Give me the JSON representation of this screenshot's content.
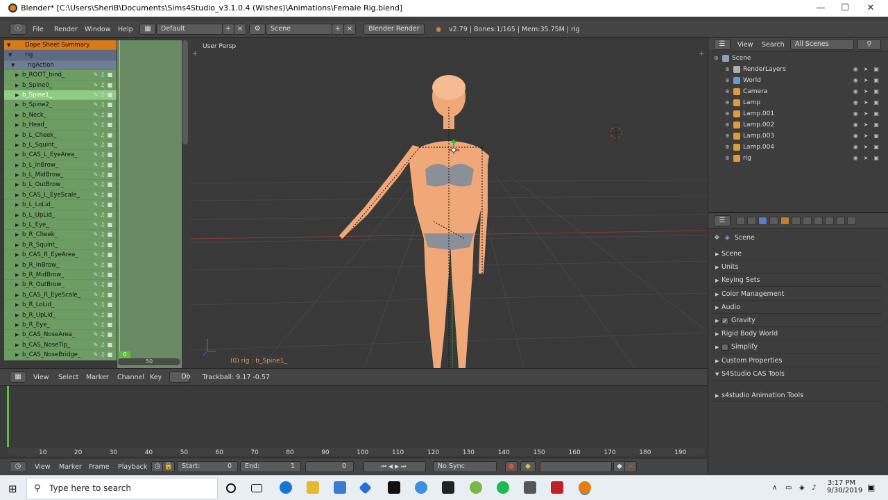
{
  "window": {
    "title": "Blender* [C:\\Users\\SheriB\\Documents\\Sims4Studio_v3.1.0.4 (Wishes)\\Animations\\Female Rig.blend]"
  },
  "menu": {
    "items": [
      "File",
      "Render",
      "Window",
      "Help"
    ],
    "layout": "Default",
    "scene": "Scene",
    "engine": "Blender Render",
    "stats": "v2.79 | Bones:1/165  | Mem:35.75M | rig"
  },
  "dopesheet": {
    "summary": "Dope Sheet Summary",
    "object": "rig",
    "action": "rigAction",
    "bones": [
      "b_ROOT_bind_",
      "b_Spine0_",
      "b_Spine1_",
      "b_Spine2_",
      "b_Neck_",
      "b_Head_",
      "b_L_Cheek_",
      "b_L_Squint_",
      "b_CAS_L_EyeArea_",
      "b_L_InBrow_",
      "b_L_MidBrow_",
      "b_L_OutBrow_",
      "b_CAS_L_EyeScale_",
      "b_L_LoLid_",
      "b_L_UpLid_",
      "b_L_Eye_",
      "b_R_Cheek_",
      "b_R_Squint_",
      "b_CAS_R_EyeArea_",
      "b_R_InBrow_",
      "b_R_MidBrow_",
      "b_R_OutBrow_",
      "b_CAS_R_EyeScale_",
      "b_R_LoLid_",
      "b_R_UpLid_",
      "b_R_Eye_",
      "b_CAS_NoseArea_",
      "b_CAS_NoseTip_",
      "b_CAS_NoseBridge_"
    ],
    "selected_bone_index": 2,
    "current_frame": "0",
    "ruler_label": "50",
    "header": {
      "items": [
        "View",
        "Select",
        "Marker",
        "Channel",
        "Key"
      ],
      "mode": "Do"
    }
  },
  "viewport": {
    "label": "User Persp",
    "object_label": "(0) rig : b_Spine1_",
    "trackball": "Trackball: 9.17 -0.57"
  },
  "outliner": {
    "header": {
      "view": "View",
      "search": "Search",
      "filter": "All Scenes"
    },
    "items": [
      {
        "name": "Scene",
        "depth": 0,
        "icon_color": "#8aa0c0"
      },
      {
        "name": "RenderLayers",
        "depth": 1,
        "icon_color": "#b0b0b0"
      },
      {
        "name": "World",
        "depth": 1,
        "icon_color": "#6a9ad0"
      },
      {
        "name": "Camera",
        "depth": 1,
        "icon_color": "#e09a3a"
      },
      {
        "name": "Lamp",
        "depth": 1,
        "icon_color": "#e09a3a"
      },
      {
        "name": "Lamp.001",
        "depth": 1,
        "icon_color": "#e09a3a"
      },
      {
        "name": "Lamp.002",
        "depth": 1,
        "icon_color": "#e09a3a"
      },
      {
        "name": "Lamp.003",
        "depth": 1,
        "icon_color": "#e09a3a"
      },
      {
        "name": "Lamp.004",
        "depth": 1,
        "icon_color": "#e09a3a"
      },
      {
        "name": "rig",
        "depth": 1,
        "icon_color": "#e09a3a"
      }
    ]
  },
  "properties": {
    "context": "Scene",
    "panels": [
      {
        "label": "Scene",
        "open": false,
        "checkbox": null
      },
      {
        "label": "Units",
        "open": false,
        "checkbox": null
      },
      {
        "label": "Keying Sets",
        "open": false,
        "checkbox": null
      },
      {
        "label": "Color Management",
        "open": false,
        "checkbox": null
      },
      {
        "label": "Audio",
        "open": false,
        "checkbox": null
      },
      {
        "label": "Gravity",
        "open": false,
        "checkbox": true
      },
      {
        "label": "Rigid Body World",
        "open": false,
        "checkbox": null
      },
      {
        "label": "Simplify",
        "open": false,
        "checkbox": false
      },
      {
        "label": "Custom Properties",
        "open": false,
        "checkbox": null
      },
      {
        "label": "S4Studio CAS Tools",
        "open": true,
        "checkbox": null
      },
      {
        "label": "s4studio Animation Tools",
        "open": false,
        "checkbox": null
      }
    ]
  },
  "timeline": {
    "ticks": [
      "10",
      "20",
      "30",
      "40",
      "50",
      "60",
      "70",
      "80",
      "90",
      "100",
      "110",
      "120",
      "130",
      "140",
      "150",
      "160",
      "170",
      "180",
      "190"
    ],
    "header": {
      "items": [
        "View",
        "Marker",
        "Frame",
        "Playback"
      ],
      "start": "Start:",
      "start_value": "0",
      "end": "End:",
      "end_value": "1",
      "current": "0",
      "sync": "No Sync"
    }
  },
  "taskbar": {
    "search_placeholder": "Type here to search",
    "time": "3:17 PM",
    "date": "9/30/2019"
  },
  "colors": {
    "blender_orange": "#e87d0d",
    "selected_bone": "#8fcd83",
    "bone_row": "#6d9d63",
    "summary": "#d97a18"
  }
}
